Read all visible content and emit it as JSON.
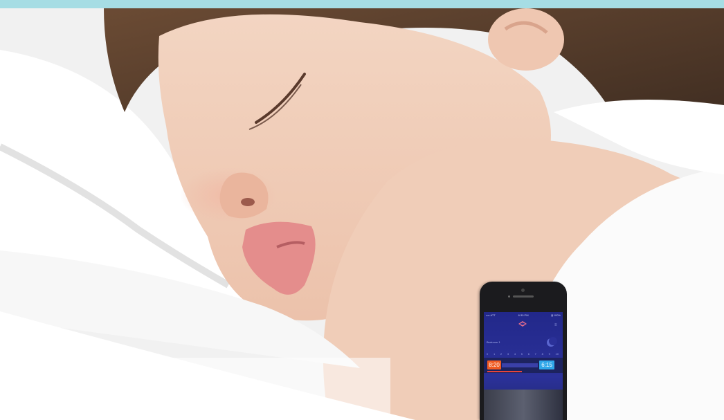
{
  "hero": {
    "image_subject": "sleeping-child",
    "accent_color": "#a6dde4"
  },
  "phone": {
    "status_left": "•••• ATT",
    "status_time": "6:30 PM",
    "status_right": "▮ 100%",
    "sub_label": "Bedroom 1",
    "scale": [
      "0",
      "1",
      "2",
      "3",
      "4",
      "5",
      "6",
      "7",
      "8",
      "9",
      "10"
    ],
    "bedtime": "8:20",
    "wake": "6:15",
    "menu_icon": "menu-icon",
    "colors": {
      "screen": "#2b3199",
      "bedtime": "#f05a22",
      "wake": "#2fa6e8"
    }
  }
}
